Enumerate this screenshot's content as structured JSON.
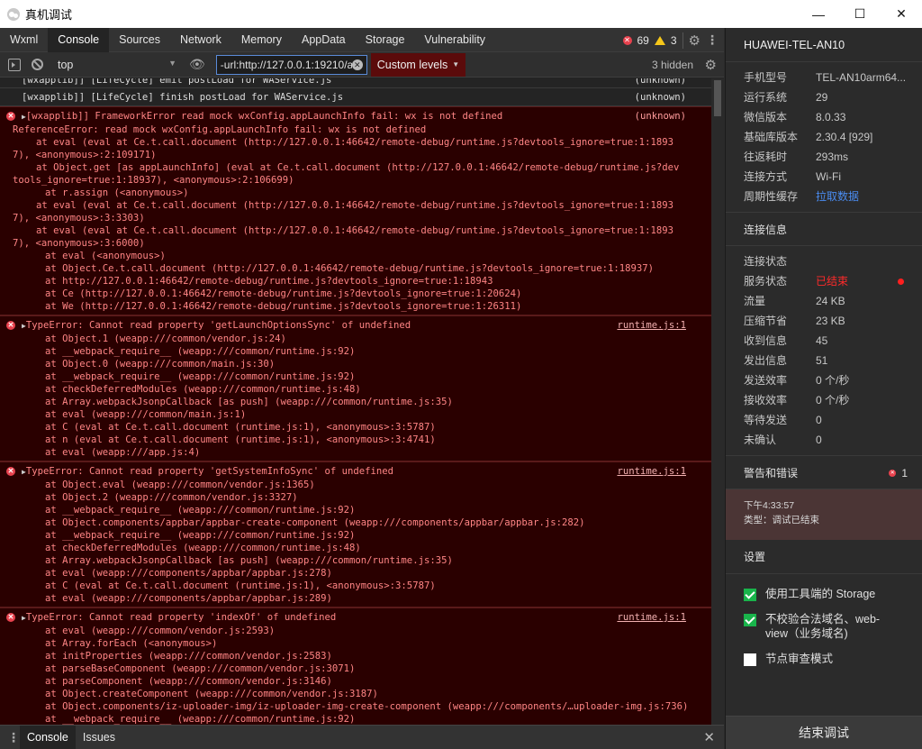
{
  "window": {
    "title": "真机调试",
    "minimize": "—",
    "maximize": "☐",
    "close": "✕"
  },
  "devtools": {
    "tabs": [
      "Wxml",
      "Console",
      "Sources",
      "Network",
      "Memory",
      "AppData",
      "Storage",
      "Vulnerability"
    ],
    "active_tab": "Console",
    "error_count": "69",
    "warning_count": "3"
  },
  "toolbar": {
    "context": "top",
    "filter_value": "-url:http://127.0.0.1:19210/a",
    "levels_label": "Custom levels",
    "hidden_label": "3 hidden"
  },
  "console": {
    "info_lines": [
      {
        "text": "[wxapplib]] [LifeCycle] emit postLoad for WAService.js",
        "src": "(unknown)"
      },
      {
        "text": "[wxapplib]] [LifeCycle] finish postLoad for WAService.js",
        "src": "(unknown)"
      }
    ],
    "errors": [
      {
        "head": "[wxapplib]] FrameworkError read mock wxConfig.appLaunchInfo fail: wx is not defined",
        "src": "(unknown)",
        "sub": "ReferenceError: read mock wxConfig.appLaunchInfo fail: wx is not defined",
        "stack": [
          "at eval (eval at Ce.t.call.document (http://127.0.0.1:46642/remote-debug/runtime.js?devtools_ignore=true:1:18937), <anonymous>:2:109171)",
          "at Object.get [as appLaunchInfo] (eval at Ce.t.call.document (http://127.0.0.1:46642/remote-debug/runtime.js?devtools_ignore=true:1:18937), <anonymous>:2:106699)",
          "at r.assign (<anonymous>)",
          "at eval (eval at Ce.t.call.document (http://127.0.0.1:46642/remote-debug/runtime.js?devtools_ignore=true:1:18937), <anonymous>:3:3303)",
          "at eval (eval at Ce.t.call.document (http://127.0.0.1:46642/remote-debug/runtime.js?devtools_ignore=true:1:18937), <anonymous>:3:6000)",
          "at eval (<anonymous>)",
          "at Object.Ce.t.call.document (http://127.0.0.1:46642/remote-debug/runtime.js?devtools_ignore=true:1:18937)",
          "at http://127.0.0.1:46642/remote-debug/runtime.js?devtools_ignore=true:1:18943",
          "at Ce (http://127.0.0.1:46642/remote-debug/runtime.js?devtools_ignore=true:1:20624)",
          "at We (http://127.0.0.1:46642/remote-debug/runtime.js?devtools_ignore=true:1:26311)"
        ]
      },
      {
        "head": "TypeError: Cannot read property 'getLaunchOptionsSync' of undefined",
        "src": "runtime.js:1",
        "sub": "",
        "stack": [
          "at Object.1 (weapp:///common/vendor.js:24)",
          "at __webpack_require__ (weapp:///common/runtime.js:92)",
          "at Object.0 (weapp:///common/main.js:30)",
          "at __webpack_require__ (weapp:///common/runtime.js:92)",
          "at checkDeferredModules (weapp:///common/runtime.js:48)",
          "at Array.webpackJsonpCallback [as push] (weapp:///common/runtime.js:35)",
          "at eval (weapp:///common/main.js:1)",
          "at C (eval at Ce.t.call.document (runtime.js:1), <anonymous>:3:5787)",
          "at n (eval at Ce.t.call.document (runtime.js:1), <anonymous>:3:4741)",
          "at eval (weapp:///app.js:4)"
        ]
      },
      {
        "head": "TypeError: Cannot read property 'getSystemInfoSync' of undefined",
        "src": "runtime.js:1",
        "sub": "",
        "stack": [
          "at Object.eval (weapp:///common/vendor.js:1365)",
          "at Object.2 (weapp:///common/vendor.js:3327)",
          "at __webpack_require__ (weapp:///common/runtime.js:92)",
          "at Object.components/appbar/appbar-create-component (weapp:///components/appbar/appbar.js:282)",
          "at __webpack_require__ (weapp:///common/runtime.js:92)",
          "at checkDeferredModules (weapp:///common/runtime.js:48)",
          "at Array.webpackJsonpCallback [as push] (weapp:///common/runtime.js:35)",
          "at eval (weapp:///components/appbar/appbar.js:278)",
          "at C (eval at Ce.t.call.document (runtime.js:1), <anonymous>:3:5787)",
          "at eval (weapp:///components/appbar/appbar.js:289)"
        ]
      },
      {
        "head": "TypeError: Cannot read property 'indexOf' of undefined",
        "src": "runtime.js:1",
        "sub": "",
        "stack": [
          "at eval (weapp:///common/vendor.js:2593)",
          "at Array.forEach (<anonymous>)",
          "at initProperties (weapp:///common/vendor.js:2583)",
          "at parseBaseComponent (weapp:///common/vendor.js:3071)",
          "at parseComponent (weapp:///common/vendor.js:3146)",
          "at Object.createComponent (weapp:///common/vendor.js:3187)",
          "at Object.components/iz-uploader-img/iz-uploader-img-create-component (weapp:///components/…uploader-img.js:736)",
          "at __webpack_require__ (weapp:///common/runtime.js:92)"
        ]
      }
    ]
  },
  "drawer": {
    "tabs": [
      "Console",
      "Issues"
    ],
    "active": "Console"
  },
  "panel": {
    "device_name": "HUAWEI-TEL-AN10",
    "device_info": [
      {
        "k": "手机型号",
        "v": "TEL-AN10arm64..."
      },
      {
        "k": "运行系统",
        "v": "29"
      },
      {
        "k": "微信版本",
        "v": "8.0.33"
      },
      {
        "k": "基础库版本",
        "v": "2.30.4 [929]"
      },
      {
        "k": "往返耗时",
        "v": "293ms"
      },
      {
        "k": "连接方式",
        "v": "Wi-Fi"
      },
      {
        "k": "周期性缓存",
        "v": "拉取数据"
      }
    ],
    "connection_title": "连接信息",
    "connection_status_label": "连接状态",
    "connection_info": [
      {
        "k": "服务状态",
        "v": "已结束"
      },
      {
        "k": "流量",
        "v": "24 KB"
      },
      {
        "k": "压缩节省",
        "v": "23 KB"
      },
      {
        "k": "收到信息",
        "v": "45"
      },
      {
        "k": "发出信息",
        "v": "51"
      },
      {
        "k": "发送效率",
        "v": "0 个/秒"
      },
      {
        "k": "接收效率",
        "v": "0 个/秒"
      },
      {
        "k": "等待发送",
        "v": "0"
      },
      {
        "k": "未确认",
        "v": "0"
      }
    ],
    "alerts_title": "警告和错误",
    "alerts_count": "1",
    "alert_time": "下午4:33:57",
    "alert_type": "类型：调试已结束",
    "settings_title": "设置",
    "settings": [
      {
        "label": "使用工具端的 Storage",
        "checked": true
      },
      {
        "label": "不校验合法域名、web-view（业务域名)",
        "checked": true
      },
      {
        "label": "节点审查模式",
        "checked": false
      }
    ],
    "end_button": "结束调试"
  },
  "colors": {
    "error_text": "#ff8585",
    "error_bg": "#2a0000",
    "status_red": "#ff2a2a",
    "link_blue": "#4a8cf0",
    "checkbox_green": "#19b44b"
  }
}
